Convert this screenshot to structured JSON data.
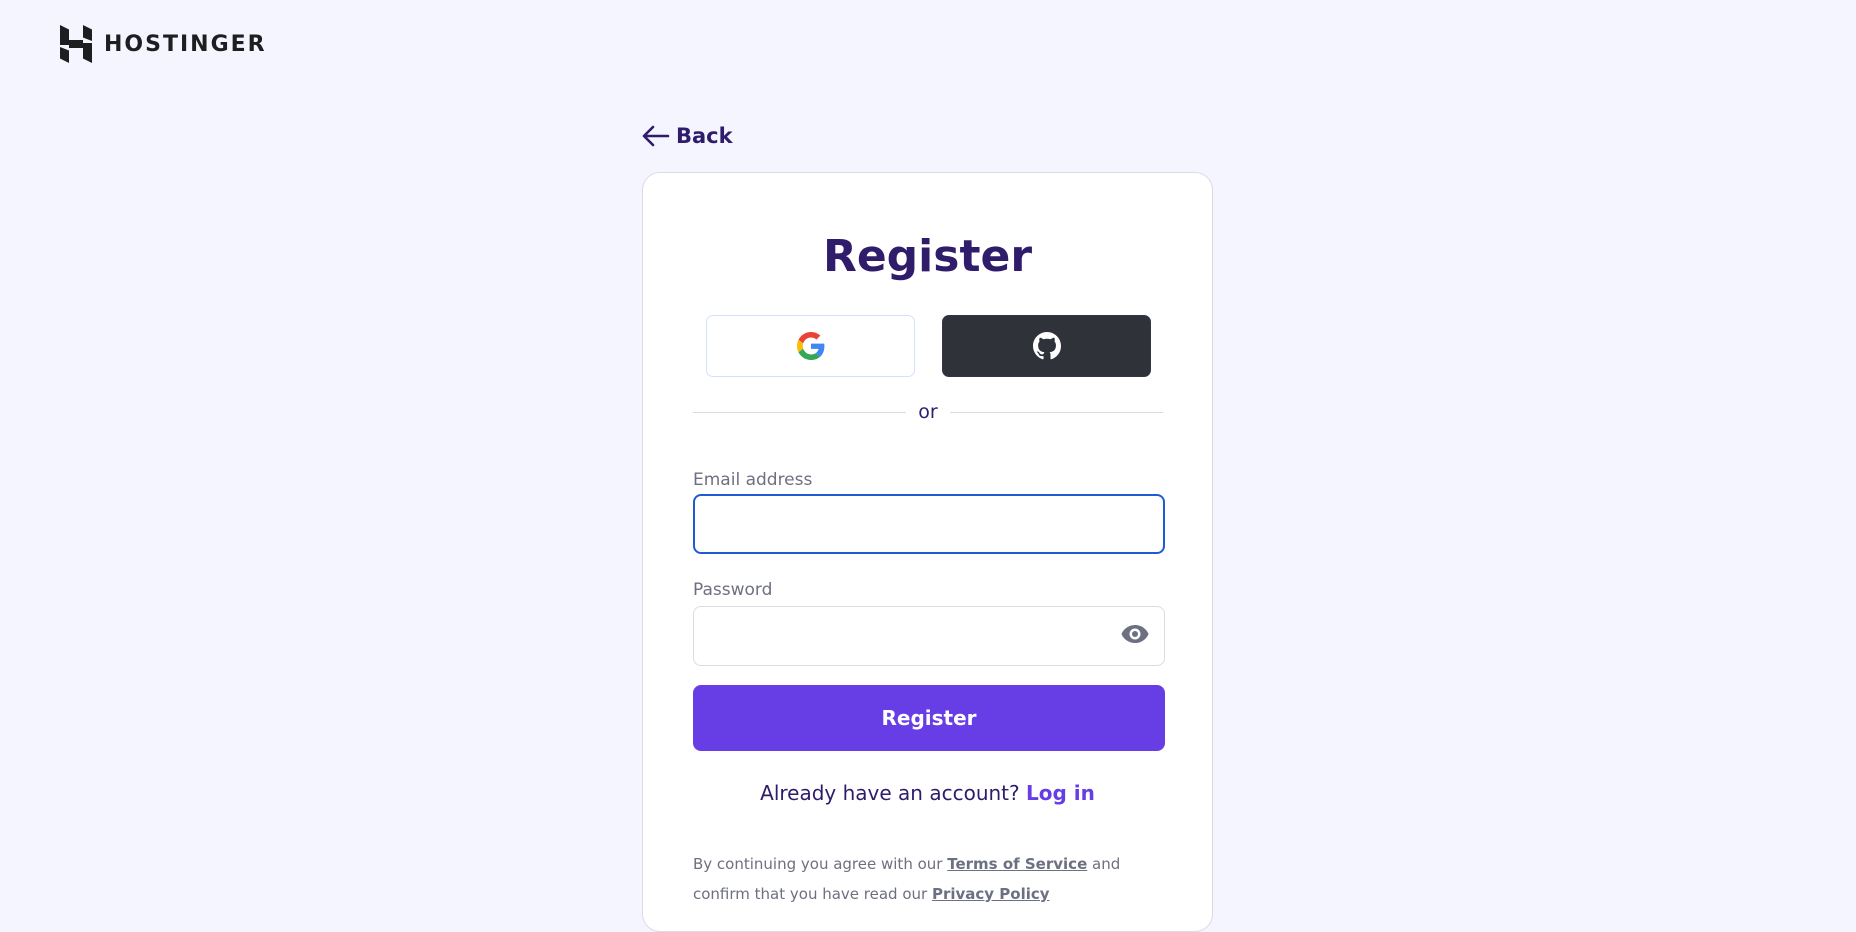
{
  "brand": {
    "name": "HOSTINGER"
  },
  "nav": {
    "back_label": "Back"
  },
  "form": {
    "title": "Register",
    "social": {
      "google_icon": "google-icon",
      "github_icon": "github-icon"
    },
    "divider_text": "or",
    "email": {
      "label": "Email address",
      "value": "",
      "placeholder": ""
    },
    "password": {
      "label": "Password",
      "value": "",
      "placeholder": ""
    },
    "submit_label": "Register",
    "login_prompt": "Already have an account?",
    "login_link": "Log in",
    "legal": {
      "prefix": "By continuing you agree with our",
      "terms": "Terms of Service",
      "middle": "and confirm that you have read our",
      "privacy": "Privacy Policy"
    }
  },
  "colors": {
    "background": "#f4f5ff",
    "primary": "#673de6",
    "heading": "#2f1c6a",
    "focus": "#1f5bd6",
    "github": "#2f3238"
  }
}
